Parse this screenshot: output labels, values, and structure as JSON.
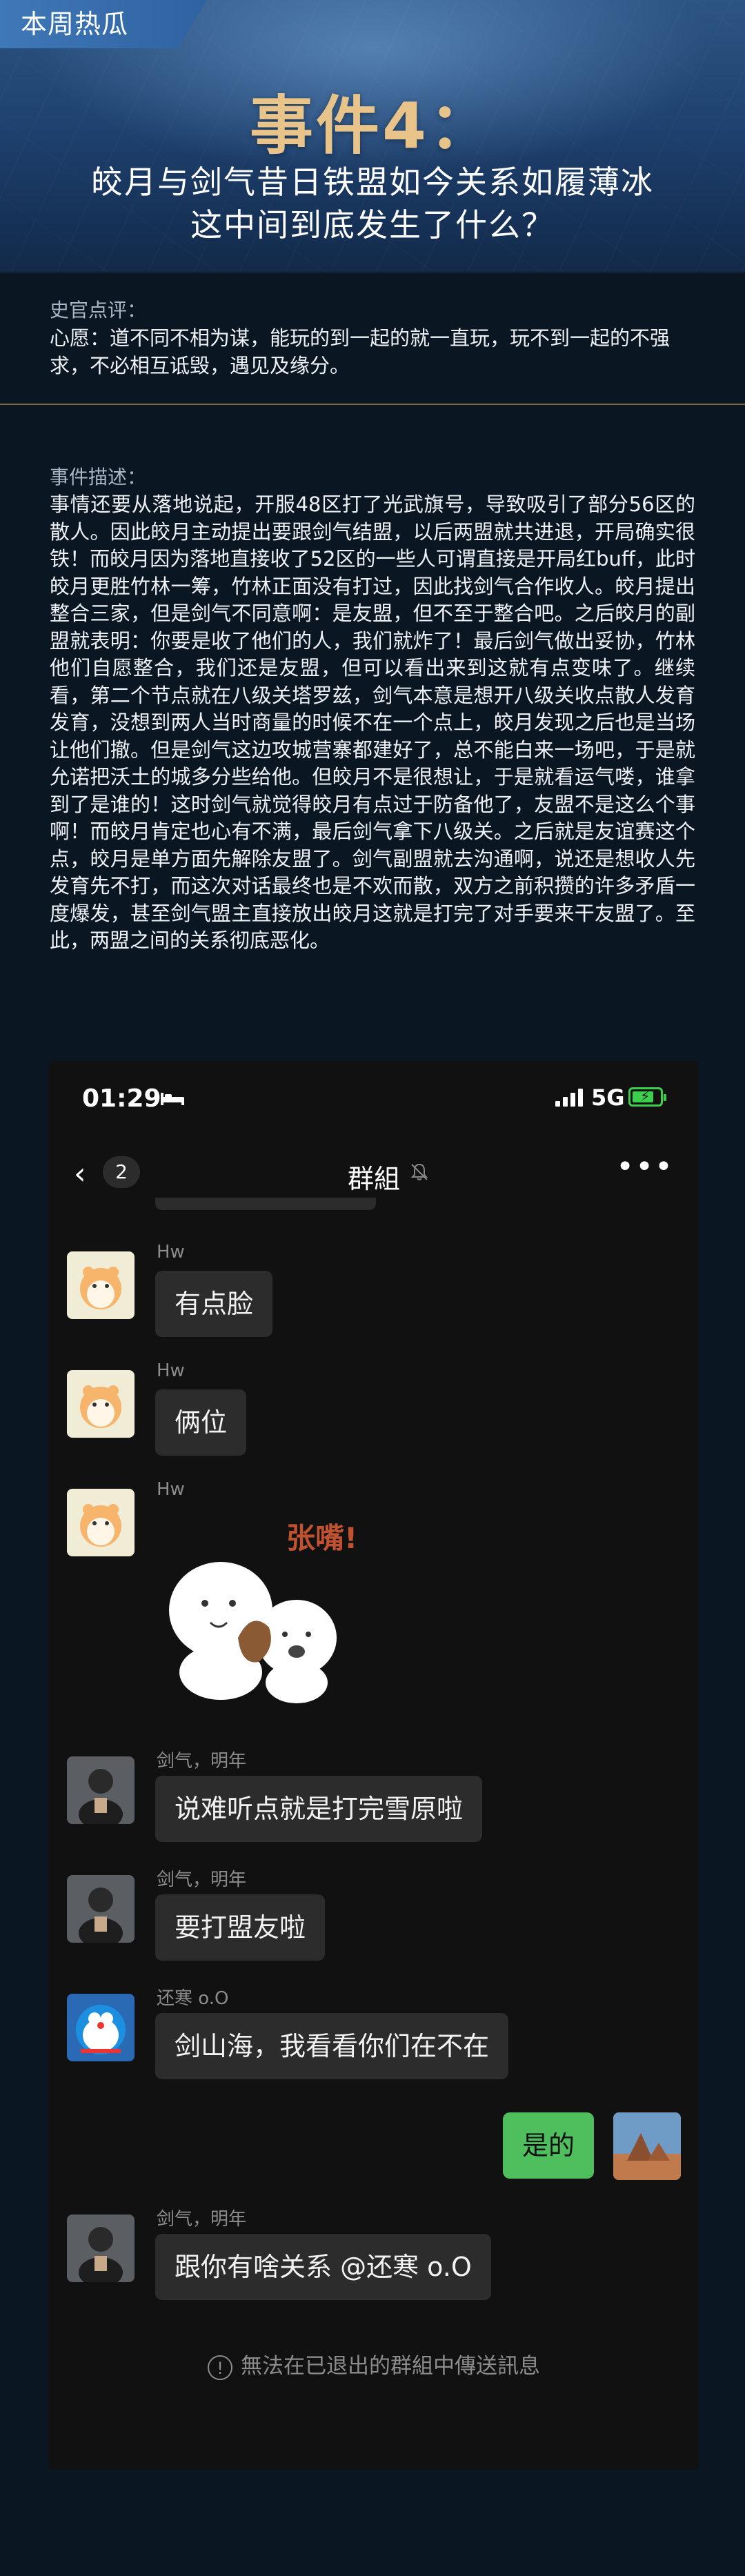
{
  "header": {
    "tag": "本周热瓜",
    "event_no": "事件4：",
    "title_line1": "皎月与剑气昔日铁盟如今关系如履薄冰",
    "title_line2": "这中间到底发生了什么？"
  },
  "comment": {
    "label": "史官点评：",
    "text": "心愿：道不同不相为谋，能玩的到一起的就一直玩，玩不到一起的不强求，不必相互诋毁，遇见及缘分。"
  },
  "description": {
    "label": "事件描述：",
    "text": "事情还要从落地说起，开服48区打了光武旗号，导致吸引了部分56区的散人。因此皎月主动提出要跟剑气结盟，以后两盟就共进退，开局确实很铁！而皎月因为落地直接收了52区的一些人可谓直接是开局红buff，此时皎月更胜竹林一筹，竹林正面没有打过，因此找剑气合作收人。皎月提出整合三家，但是剑气不同意啊：是友盟，但不至于整合吧。之后皎月的副盟就表明：你要是收了他们的人，我们就炸了！最后剑气做出妥协，竹林他们自愿整合，我们还是友盟，但可以看出来到这就有点变味了。继续看，第二个节点就在八级关塔罗兹，剑气本意是想开八级关收点散人发育发育，没想到两人当时商量的时候不在一个点上，皎月发现之后也是当场让他们撤。但是剑气这边攻城营寨都建好了，总不能白来一场吧，于是就允诺把沃土的城多分些给他。但皎月不是很想让，于是就看运气喽，谁拿到了是谁的！这时剑气就觉得皎月有点过于防备他了，友盟不是这么个事啊！而皎月肯定也心有不满，最后剑气拿下八级关。之后就是友谊赛这个点，皎月是单方面先解除友盟了。剑气副盟就去沟通啊，说还是想收人先发育先不打，而这次对话最终也是不欢而散，双方之前积攒的许多矛盾一度爆发，甚至剑气盟主直接放出皎月这就是打完了对手要来干友盟了。至此，两盟之间的关系彻底恶化。"
  },
  "phone": {
    "status": {
      "time": "01:29",
      "network": "5G"
    },
    "nav": {
      "back_count": "2",
      "title": "群組",
      "more": "•••"
    },
    "messages": [
      {
        "sender": "Hw",
        "text": "有点脸",
        "avatar": "hamster-avatar"
      },
      {
        "sender": "Hw",
        "text": "俩位",
        "avatar": "hamster-avatar"
      },
      {
        "sender": "Hw",
        "sticker": "张嘴!",
        "avatar": "hamster-avatar"
      },
      {
        "sender": "剑气，明年",
        "text": "说难听点就是打完雪原啦",
        "avatar": "person-avatar"
      },
      {
        "sender": "剑气，明年",
        "text": "要打盟友啦",
        "avatar": "person-avatar"
      },
      {
        "sender": "还寒 o.O",
        "text": "剑山海，我看看你们在不在",
        "avatar": "doraemon-avatar"
      },
      {
        "sender": "",
        "text": "是的",
        "avatar": "landscape-avatar",
        "self": true
      },
      {
        "sender": "剑气，明年",
        "text": "跟你有啥关系 @还寒 o.O",
        "avatar": "person-avatar"
      }
    ],
    "notice": "無法在已退出的群組中傳送訊息"
  },
  "colors": {
    "accent_gold": "#e8c48a",
    "bubble_self": "#4fbf5d",
    "bubble_other": "#2c2c2c"
  }
}
